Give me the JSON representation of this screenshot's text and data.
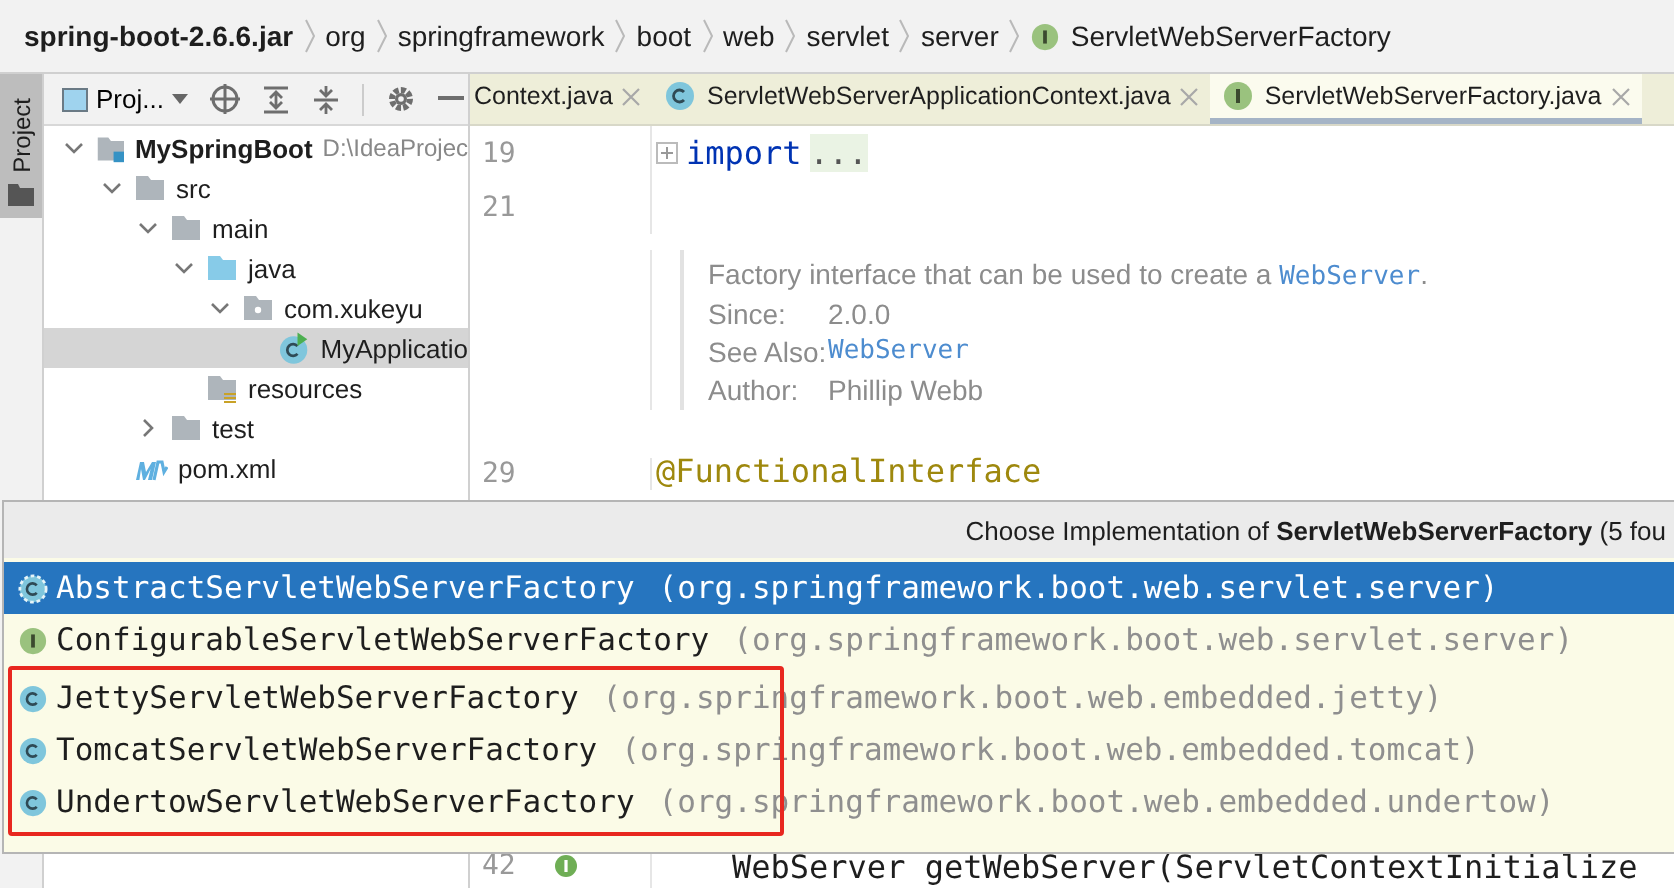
{
  "breadcrumbs": [
    {
      "label": "spring-boot-2.6.6.jar",
      "kind": "jar"
    },
    {
      "label": "org",
      "kind": "package"
    },
    {
      "label": "springframework",
      "kind": "package"
    },
    {
      "label": "boot",
      "kind": "package"
    },
    {
      "label": "web",
      "kind": "package"
    },
    {
      "label": "servlet",
      "kind": "package"
    },
    {
      "label": "server",
      "kind": "package"
    },
    {
      "label": "ServletWebServerFactory",
      "kind": "interface"
    }
  ],
  "tool_strip": {
    "label": "Project",
    "selected": true
  },
  "project_panel": {
    "view_selector": "Proj...",
    "tree": [
      {
        "label": "MySpringBoot",
        "hint": "D:\\IdeaProjec",
        "kind": "module",
        "expanded": true,
        "selected": false,
        "children": [
          {
            "label": "src",
            "kind": "folder",
            "expanded": true,
            "selected": false,
            "children": [
              {
                "label": "main",
                "kind": "folder",
                "expanded": true,
                "selected": false,
                "children": [
                  {
                    "label": "java",
                    "kind": "source-folder",
                    "expanded": true,
                    "selected": false,
                    "children": [
                      {
                        "label": "com.xukeyu",
                        "kind": "package",
                        "expanded": true,
                        "selected": false,
                        "children": [
                          {
                            "label": "MyApplicatio",
                            "kind": "app-class",
                            "selected": true
                          }
                        ]
                      }
                    ]
                  },
                  {
                    "label": "resources",
                    "kind": "resources",
                    "selected": false
                  }
                ]
              },
              {
                "label": "test",
                "kind": "folder",
                "expanded": false,
                "selected": false
              }
            ]
          },
          {
            "label": "pom.xml",
            "kind": "maven",
            "selected": false
          }
        ]
      }
    ]
  },
  "tabs": [
    {
      "label": "Context.java",
      "kind": "plain",
      "selected": false
    },
    {
      "label": "ServletWebServerApplicationContext.java",
      "kind": "class",
      "selected": false
    },
    {
      "label": "ServletWebServerFactory.java",
      "kind": "interface",
      "selected": true
    }
  ],
  "editor": {
    "lines": [
      {
        "number": "19",
        "kind": "import",
        "keyword": "import",
        "folded": "..."
      },
      {
        "number": "21",
        "kind": "blank"
      },
      {
        "kind": "doc",
        "description": [
          {
            "text": "Factory interface that can be used to create a ",
            "kind": "text"
          },
          {
            "text": "WebServer",
            "kind": "link"
          },
          {
            "text": ".",
            "kind": "text"
          }
        ],
        "fields": [
          {
            "label": "Since:",
            "value": "2.0.0",
            "kind": "text"
          },
          {
            "label": "See Also:",
            "value": "WebServer",
            "kind": "link"
          },
          {
            "label": "Author:",
            "value": "Phillip Webb",
            "kind": "text"
          }
        ]
      },
      {
        "number": "29",
        "kind": "annotation",
        "text": "@FunctionalInterface"
      }
    ],
    "bottom_line": {
      "number": "42",
      "text": "WebServer getWebServer(ServletContextInitialize",
      "implements": true
    }
  },
  "popup": {
    "title": "Choose Implementation of **ServletWebServerFactory** (5 fou",
    "items": [
      {
        "name": "AbstractServletWebServerFactory",
        "package": "(org.springframework.boot.web.servlet.server)",
        "kind": "abstract-class",
        "selected": true,
        "outlined": false
      },
      {
        "name": "ConfigurableServletWebServerFactory",
        "package": "(org.springframework.boot.web.servlet.server)",
        "kind": "interface",
        "selected": false,
        "outlined": false
      },
      {
        "name": "JettyServletWebServerFactory",
        "package": "(org.springframework.boot.web.embedded.jetty)",
        "kind": "class",
        "selected": false,
        "outlined": true
      },
      {
        "name": "TomcatServletWebServerFactory",
        "package": "(org.springframework.boot.web.embedded.tomcat)",
        "kind": "class",
        "selected": false,
        "outlined": true
      },
      {
        "name": "UndertowServletWebServerFactory",
        "package": "(org.springframework.boot.web.embedded.undertow)",
        "kind": "class",
        "selected": false,
        "outlined": true
      }
    ]
  }
}
